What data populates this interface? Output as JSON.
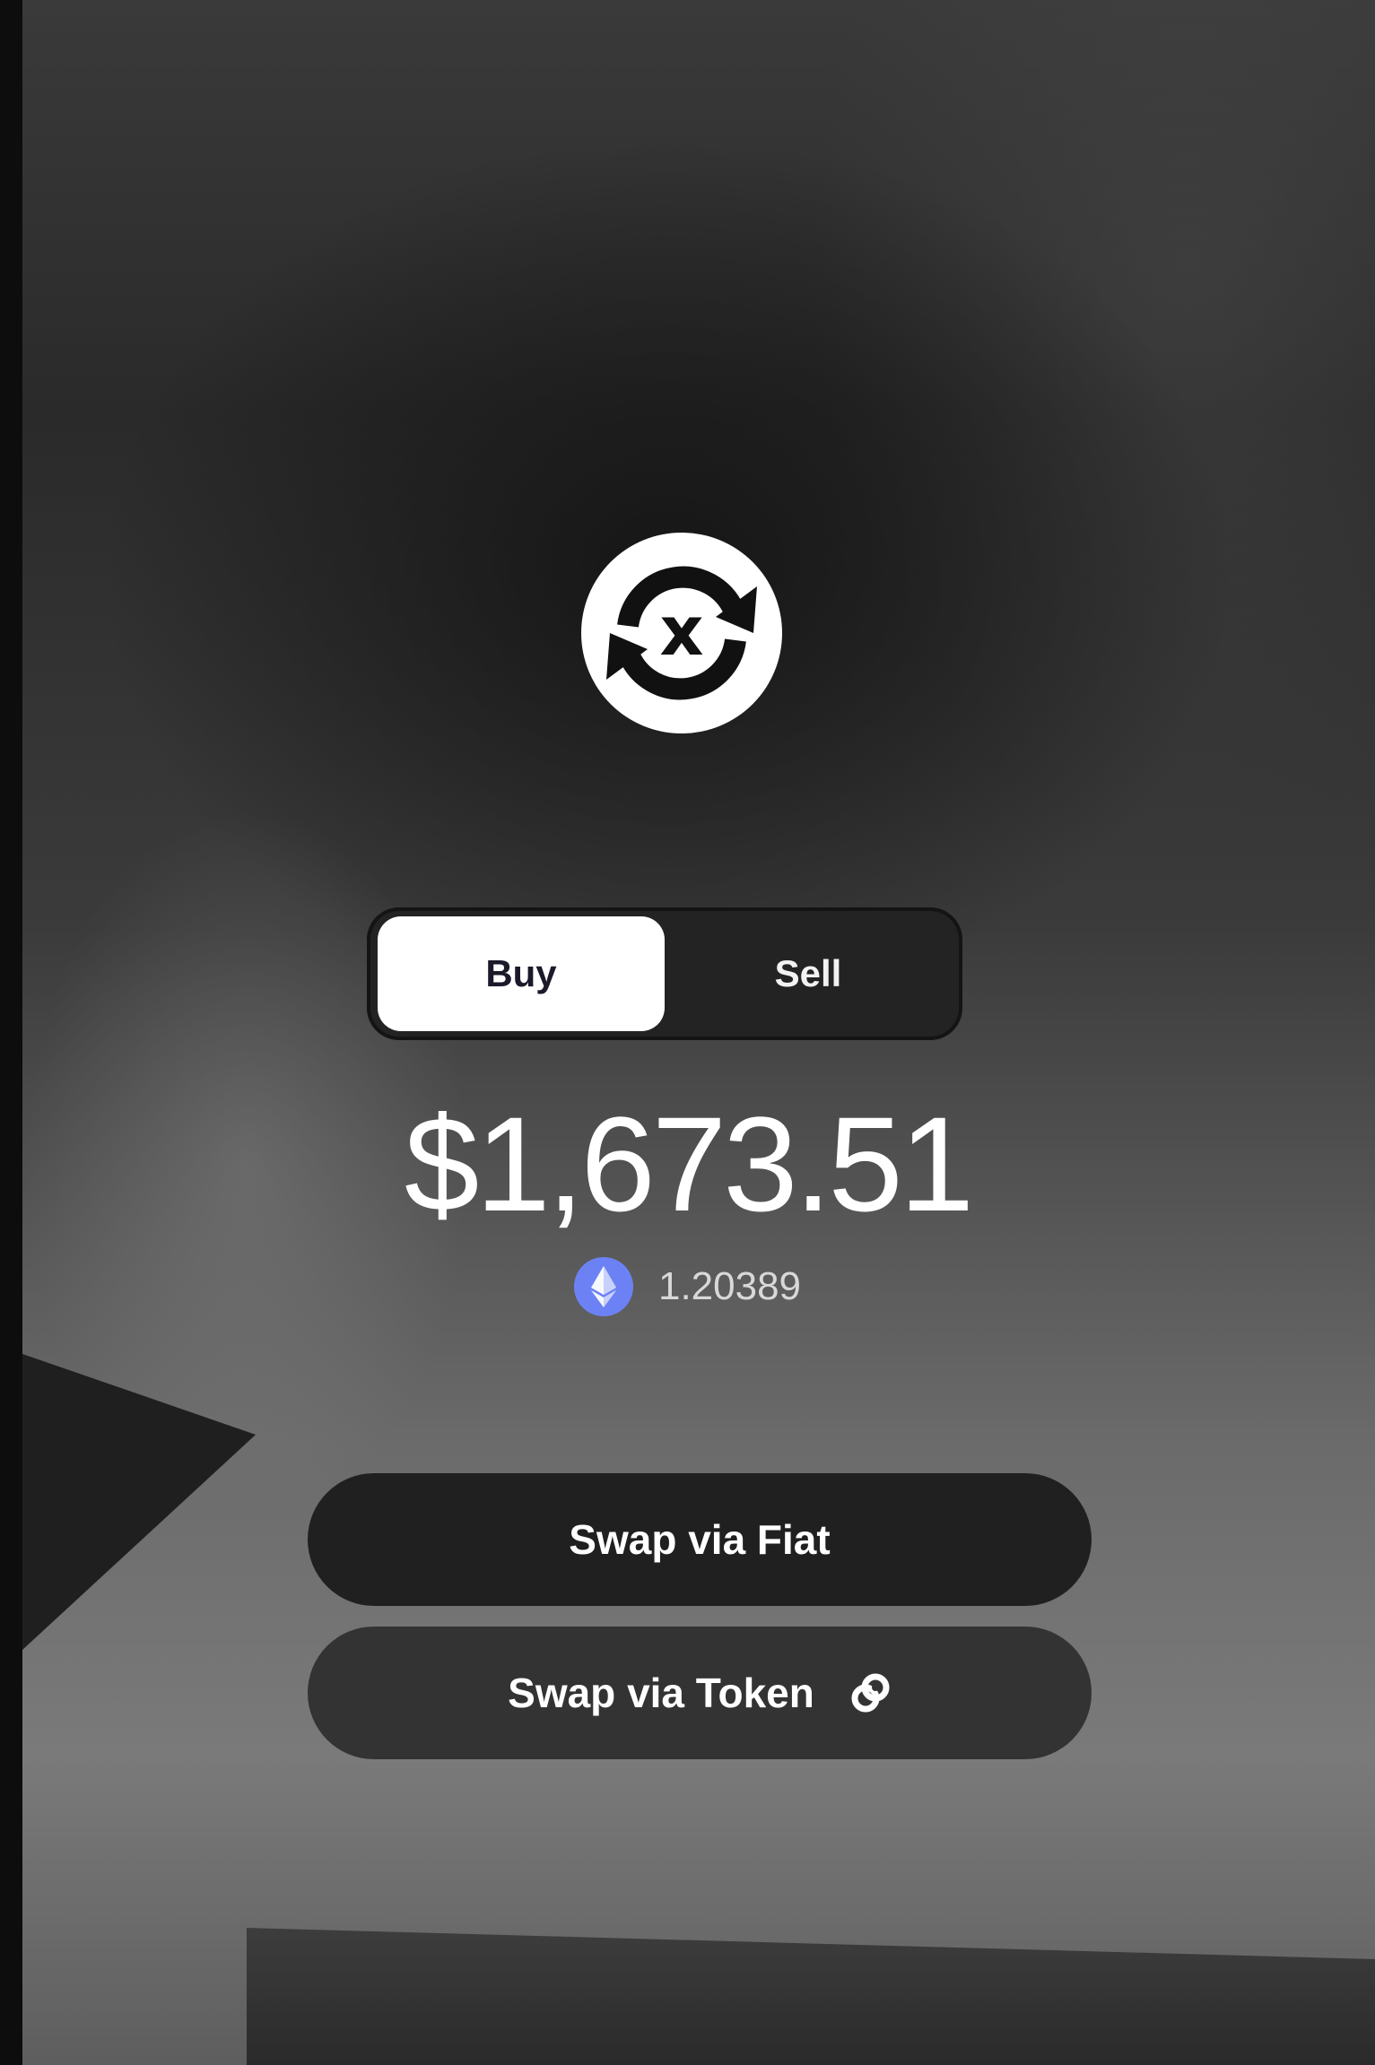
{
  "toggle": {
    "buy_label": "Buy",
    "sell_label": "Sell",
    "selected": "Buy"
  },
  "balance": {
    "fiat_amount": "$1,673.51",
    "token_icon": "ethereum-icon",
    "token_amount": "1.20389"
  },
  "actions": {
    "swap_fiat_label": "Swap via Fiat",
    "swap_token_label": "Swap via Token",
    "swap_token_icon": "link-icon"
  },
  "logo": {
    "icon": "swap-x-logo-icon"
  },
  "colors": {
    "eth_blue": "#6c82f4",
    "button_dark": "#202020",
    "button_gray": "#333333",
    "toggle_active": "#ffffff"
  }
}
